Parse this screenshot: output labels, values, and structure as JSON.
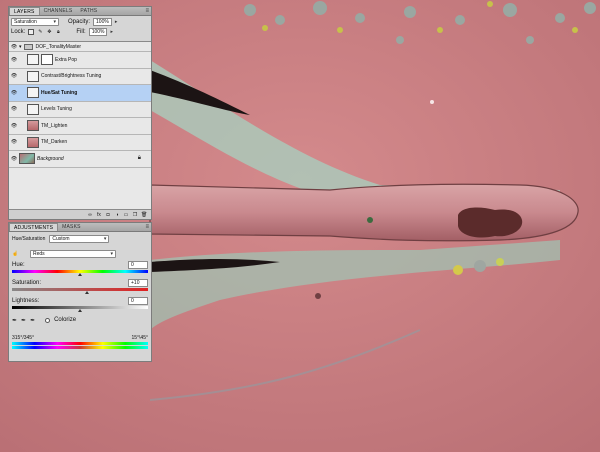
{
  "layers_panel": {
    "tabs": [
      "LAYERS",
      "CHANNELS",
      "PATHS"
    ],
    "blend_mode": "Saturation",
    "opacity_label": "Opacity:",
    "opacity_value": "100%",
    "lock_label": "Lock:",
    "fill_label": "Fill:",
    "fill_value": "100%",
    "layers": [
      {
        "name": "DOF_TonalityMaster",
        "kind": "group"
      },
      {
        "name": "Extra Pop",
        "kind": "adjustment_mask"
      },
      {
        "name": "Contrast/Brightness Tuning",
        "kind": "adjustment"
      },
      {
        "name": "Hue/Sat Tuning",
        "kind": "adjustment",
        "selected": true
      },
      {
        "name": "Levels Tuning",
        "kind": "adjustment"
      },
      {
        "name": "TM_Lighten",
        "kind": "red"
      },
      {
        "name": "TM_Darken",
        "kind": "red"
      },
      {
        "name": "Background",
        "kind": "image",
        "locked": true
      }
    ]
  },
  "adjustments_panel": {
    "tabs": [
      "ADJUSTMENTS",
      "MASKS"
    ],
    "adjustment_name": "Hue/Saturation",
    "preset": "Custom",
    "channel": "Reds",
    "hue_label": "Hue:",
    "hue_value": "0",
    "hue_level": 0.5,
    "saturation_label": "Saturation:",
    "saturation_value": "+10",
    "saturation_level": 0.55,
    "lightness_label": "Lightness:",
    "lightness_value": "0",
    "lightness_level": 0.5,
    "colorize_label": "Colorize",
    "range_left": "315°/345°",
    "range_right": "15°\\45°"
  },
  "colors": {
    "selected_row": "#b5d1f4",
    "photo_base": "#c87c80",
    "rust": "#5b2b2b",
    "patina": "#9fc7b3"
  }
}
